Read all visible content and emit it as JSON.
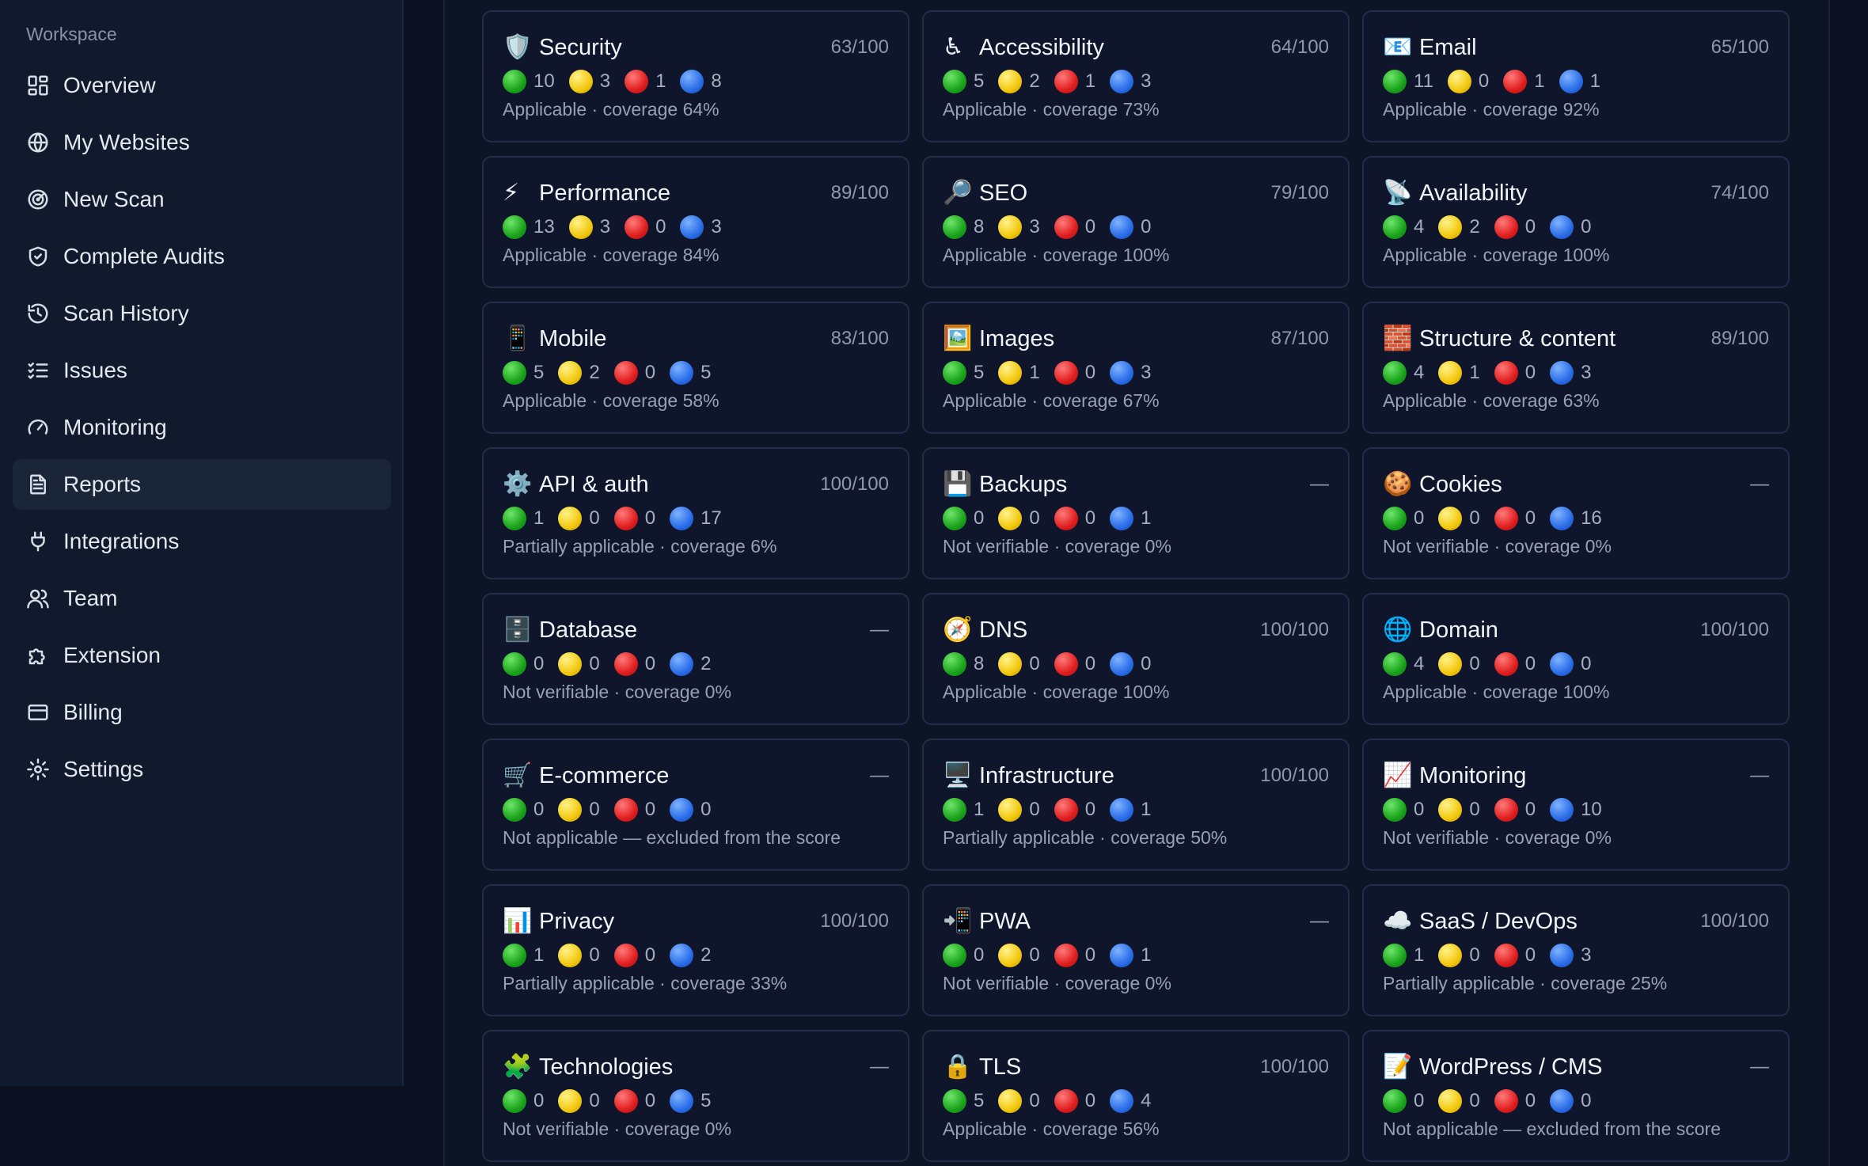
{
  "sidebar": {
    "section_label": "Workspace",
    "items": [
      {
        "label": "Overview",
        "icon": "grid-icon",
        "active": false
      },
      {
        "label": "My Websites",
        "icon": "globe-icon",
        "active": false
      },
      {
        "label": "New Scan",
        "icon": "radar-icon",
        "active": false
      },
      {
        "label": "Complete Audits",
        "icon": "shield-check-icon",
        "active": false
      },
      {
        "label": "Scan History",
        "icon": "history-icon",
        "active": false
      },
      {
        "label": "Issues",
        "icon": "checklist-icon",
        "active": false
      },
      {
        "label": "Monitoring",
        "icon": "gauge-icon",
        "active": false
      },
      {
        "label": "Reports",
        "icon": "file-text-icon",
        "active": true
      },
      {
        "label": "Integrations",
        "icon": "plug-icon",
        "active": false
      },
      {
        "label": "Team",
        "icon": "users-icon",
        "active": false
      },
      {
        "label": "Extension",
        "icon": "puzzle-icon",
        "active": false
      },
      {
        "label": "Billing",
        "icon": "credit-card-icon",
        "active": false
      },
      {
        "label": "Settings",
        "icon": "gear-icon",
        "active": false
      }
    ]
  },
  "categories": [
    {
      "emoji": "🛡️",
      "title": "Security",
      "score": "63/100",
      "green": "10",
      "yellow": "3",
      "red": "1",
      "blue": "8",
      "status": "Applicable · coverage 64%"
    },
    {
      "emoji": "♿",
      "title": "Accessibility",
      "score": "64/100",
      "green": "5",
      "yellow": "2",
      "red": "1",
      "blue": "3",
      "status": "Applicable · coverage 73%"
    },
    {
      "emoji": "📧",
      "title": "Email",
      "score": "65/100",
      "green": "11",
      "yellow": "0",
      "red": "1",
      "blue": "1",
      "status": "Applicable · coverage 92%"
    },
    {
      "emoji": "⚡",
      "title": "Performance",
      "score": "89/100",
      "green": "13",
      "yellow": "3",
      "red": "0",
      "blue": "3",
      "status": "Applicable · coverage 84%"
    },
    {
      "emoji": "🔎",
      "title": "SEO",
      "score": "79/100",
      "green": "8",
      "yellow": "3",
      "red": "0",
      "blue": "0",
      "status": "Applicable · coverage 100%"
    },
    {
      "emoji": "📡",
      "title": "Availability",
      "score": "74/100",
      "green": "4",
      "yellow": "2",
      "red": "0",
      "blue": "0",
      "status": "Applicable · coverage 100%"
    },
    {
      "emoji": "📱",
      "title": "Mobile",
      "score": "83/100",
      "green": "5",
      "yellow": "2",
      "red": "0",
      "blue": "5",
      "status": "Applicable · coverage 58%"
    },
    {
      "emoji": "🖼️",
      "title": "Images",
      "score": "87/100",
      "green": "5",
      "yellow": "1",
      "red": "0",
      "blue": "3",
      "status": "Applicable · coverage 67%"
    },
    {
      "emoji": "🧱",
      "title": "Structure & content",
      "score": "89/100",
      "green": "4",
      "yellow": "1",
      "red": "0",
      "blue": "3",
      "status": "Applicable · coverage 63%"
    },
    {
      "emoji": "⚙️",
      "title": "API & auth",
      "score": "100/100",
      "green": "1",
      "yellow": "0",
      "red": "0",
      "blue": "17",
      "status": "Partially applicable · coverage 6%"
    },
    {
      "emoji": "💾",
      "title": "Backups",
      "score": "—",
      "green": "0",
      "yellow": "0",
      "red": "0",
      "blue": "1",
      "status": "Not verifiable · coverage 0%"
    },
    {
      "emoji": "🍪",
      "title": "Cookies",
      "score": "—",
      "green": "0",
      "yellow": "0",
      "red": "0",
      "blue": "16",
      "status": "Not verifiable · coverage 0%"
    },
    {
      "emoji": "🗄️",
      "title": "Database",
      "score": "—",
      "green": "0",
      "yellow": "0",
      "red": "0",
      "blue": "2",
      "status": "Not verifiable · coverage 0%"
    },
    {
      "emoji": "🧭",
      "title": "DNS",
      "score": "100/100",
      "green": "8",
      "yellow": "0",
      "red": "0",
      "blue": "0",
      "status": "Applicable · coverage 100%"
    },
    {
      "emoji": "🌐",
      "title": "Domain",
      "score": "100/100",
      "green": "4",
      "yellow": "0",
      "red": "0",
      "blue": "0",
      "status": "Applicable · coverage 100%"
    },
    {
      "emoji": "🛒",
      "title": "E-commerce",
      "score": "—",
      "green": "0",
      "yellow": "0",
      "red": "0",
      "blue": "0",
      "status": "Not applicable — excluded from the score"
    },
    {
      "emoji": "🖥️",
      "title": "Infrastructure",
      "score": "100/100",
      "green": "1",
      "yellow": "0",
      "red": "0",
      "blue": "1",
      "status": "Partially applicable · coverage 50%"
    },
    {
      "emoji": "📈",
      "title": "Monitoring",
      "score": "—",
      "green": "0",
      "yellow": "0",
      "red": "0",
      "blue": "10",
      "status": "Not verifiable · coverage 0%"
    },
    {
      "emoji": "📊",
      "title": "Privacy",
      "score": "100/100",
      "green": "1",
      "yellow": "0",
      "red": "0",
      "blue": "2",
      "status": "Partially applicable · coverage 33%"
    },
    {
      "emoji": "📲",
      "title": "PWA",
      "score": "—",
      "green": "0",
      "yellow": "0",
      "red": "0",
      "blue": "1",
      "status": "Not verifiable · coverage 0%"
    },
    {
      "emoji": "☁️",
      "title": "SaaS / DevOps",
      "score": "100/100",
      "green": "1",
      "yellow": "0",
      "red": "0",
      "blue": "3",
      "status": "Partially applicable · coverage 25%"
    },
    {
      "emoji": "🧩",
      "title": "Technologies",
      "score": "—",
      "green": "0",
      "yellow": "0",
      "red": "0",
      "blue": "5",
      "status": "Not verifiable · coverage 0%"
    },
    {
      "emoji": "🔒",
      "title": "TLS",
      "score": "100/100",
      "green": "5",
      "yellow": "0",
      "red": "0",
      "blue": "4",
      "status": "Applicable · coverage 56%"
    },
    {
      "emoji": "📝",
      "title": "WordPress / CMS",
      "score": "—",
      "green": "0",
      "yellow": "0",
      "red": "0",
      "blue": "0",
      "status": "Not applicable — excluded from the score"
    }
  ],
  "colors": {
    "background": "#0b1120",
    "sidebar": "#111a2c",
    "card": "#0f162b",
    "active_nav": "#1b2538",
    "pass": "#1aa31a",
    "warn": "#f2c80f",
    "fail": "#e01e1e",
    "info": "#2a6ee8"
  }
}
